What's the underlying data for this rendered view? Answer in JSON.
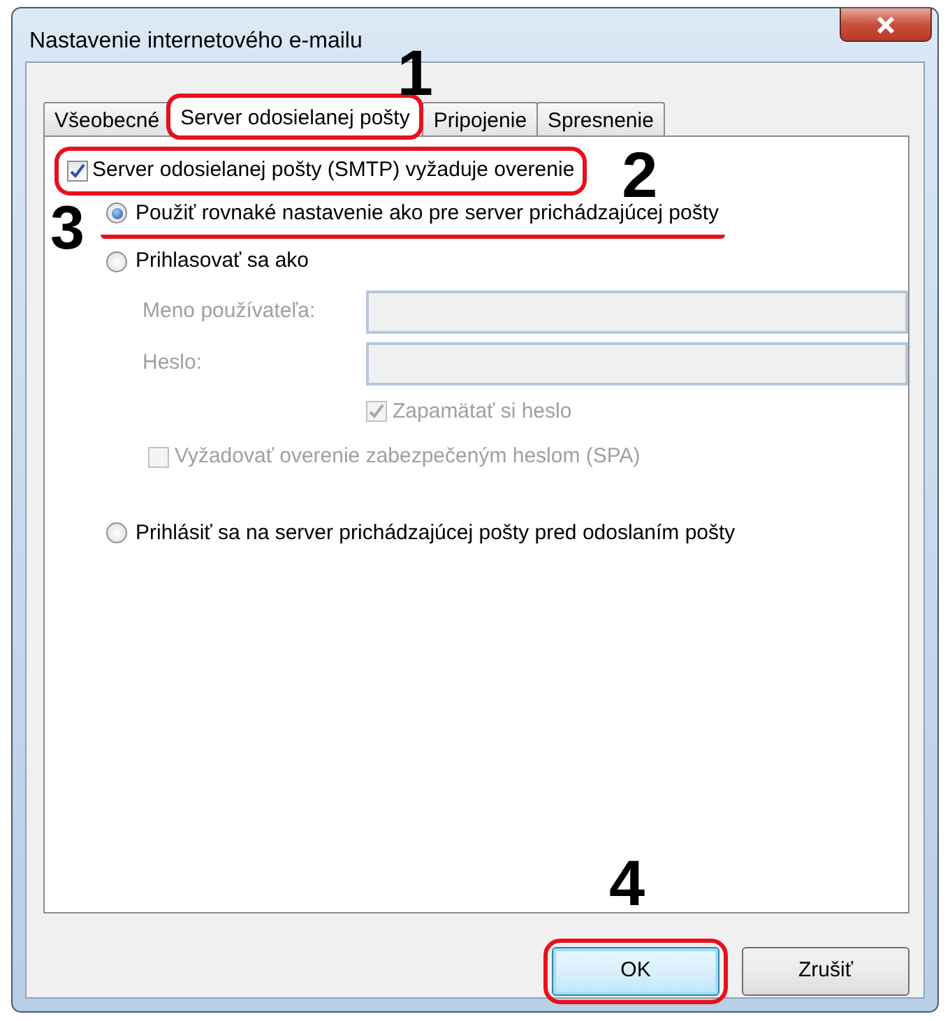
{
  "window": {
    "title": "Nastavenie internetového e-mailu"
  },
  "tabs": [
    {
      "label": "Všeobecné",
      "selected": false
    },
    {
      "label": "Server odosielanej pošty",
      "selected": true,
      "highlighted": true,
      "callout": "1"
    },
    {
      "label": "Pripojenie",
      "selected": false
    },
    {
      "label": "Spresnenie",
      "selected": false
    }
  ],
  "auth_checkbox": {
    "label": "Server odosielanej pošty (SMTP) vyžaduje overenie",
    "checked": true,
    "highlighted": true,
    "callout": "2"
  },
  "send_options": [
    {
      "label": "Použiť rovnaké nastavenie ako pre server prichádzajúcej pošty",
      "selected": true,
      "underlined": true,
      "callout": "3"
    },
    {
      "label": "Prihlasovať sa ako",
      "selected": false,
      "credentials": {
        "disabled": true,
        "fields": [
          {
            "label": "Meno používateľa:"
          },
          {
            "label": "Heslo:"
          }
        ],
        "remember": {
          "label": "Zapamätať si heslo",
          "checked": true
        },
        "spa": {
          "label": "Vyžadovať overenie zabezpečeným heslom (SPA)",
          "checked": false
        }
      }
    },
    {
      "label": "Prihlásiť sa na server prichádzajúcej pošty pred odoslaním pošty",
      "selected": false
    }
  ],
  "buttons": [
    {
      "label": "OK",
      "default": true,
      "highlighted": true,
      "callout": "4"
    },
    {
      "label": "Zrušiť",
      "default": false
    }
  ]
}
